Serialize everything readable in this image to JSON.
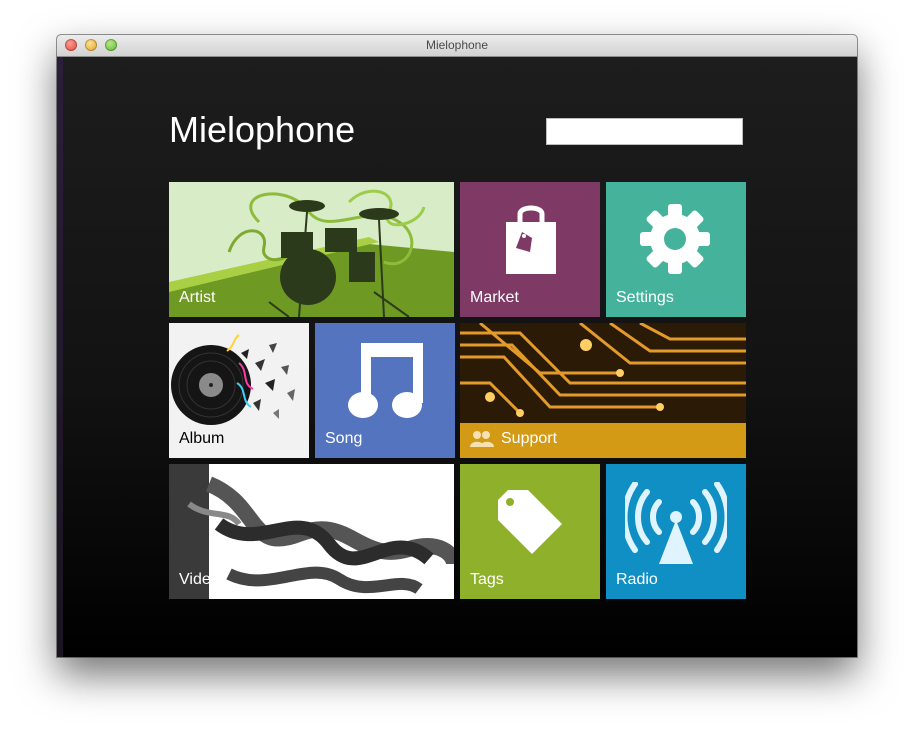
{
  "window": {
    "title": "Mielophone"
  },
  "header": {
    "title": "Mielophone"
  },
  "search": {
    "value": "",
    "placeholder": ""
  },
  "tiles": {
    "artist": {
      "label": "Artist",
      "color": "#d9ecc8"
    },
    "market": {
      "label": "Market",
      "color": "#7e3965"
    },
    "settings": {
      "label": "Settings",
      "color": "#45b39b"
    },
    "album": {
      "label": "Album",
      "color": "#f2f2f2"
    },
    "song": {
      "label": "Song",
      "color": "#5474c0"
    },
    "support": {
      "label": "Support",
      "color": "#d39a16"
    },
    "video": {
      "label": "Video",
      "color": "#ffffff"
    },
    "tags": {
      "label": "Tags",
      "color": "#8fb02a"
    },
    "radio": {
      "label": "Radio",
      "color": "#0f8fc3"
    }
  },
  "icons": {
    "artist": "drum-kit-image",
    "market": "shopping-bag-icon",
    "settings": "gear-icon",
    "album": "vinyl-record-image",
    "song": "music-note-icon",
    "support": "people-icon",
    "video": "film-reel-image",
    "tags": "tag-icon",
    "radio": "radio-tower-icon"
  }
}
